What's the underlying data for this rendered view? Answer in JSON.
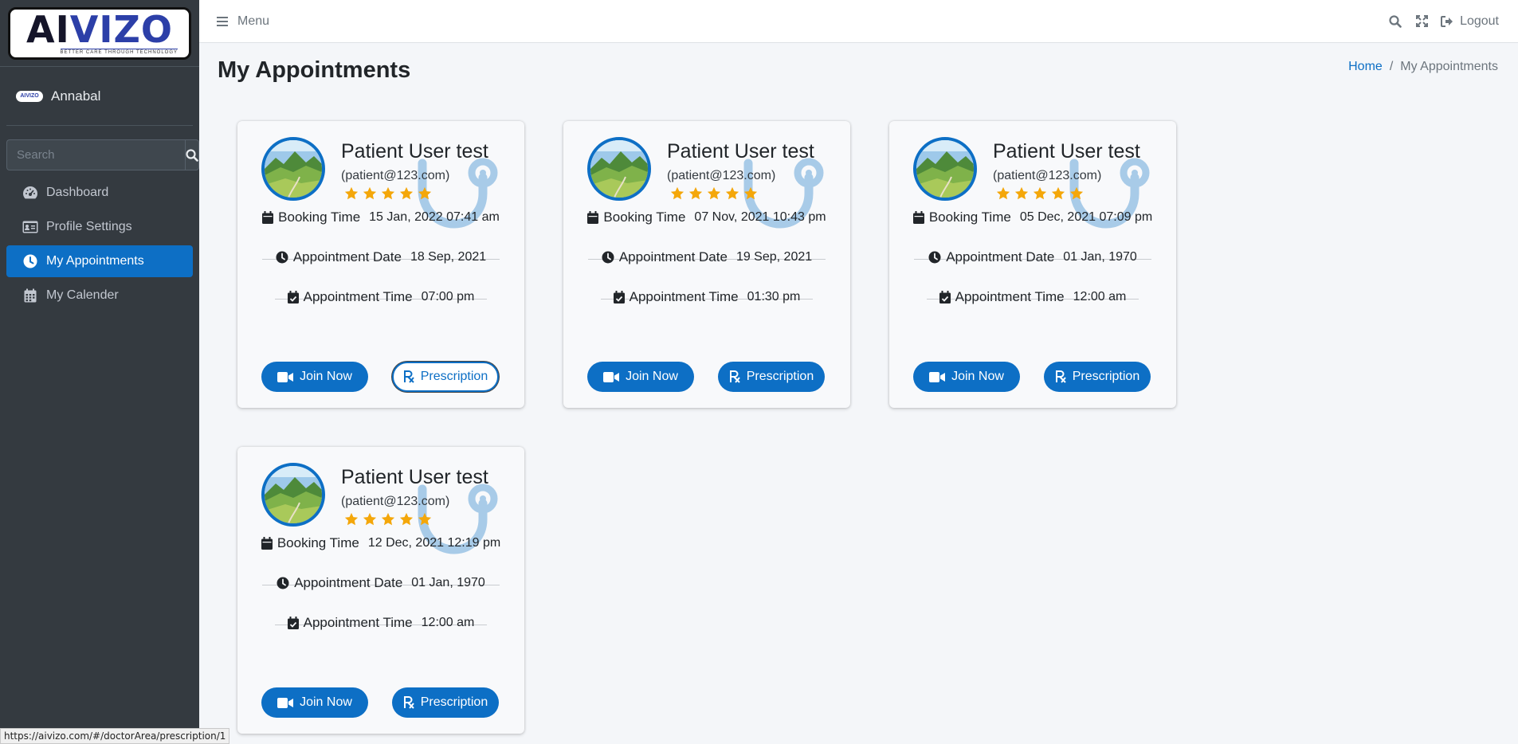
{
  "brand": {
    "logo_text_dark": "AI",
    "logo_text_accent": "VIZO",
    "logo_text_end": "",
    "tagline": "BETTER CARE THROUGH TECHNOLOGY"
  },
  "user": {
    "avatar_text": "AIVIZO",
    "name": "Annabal"
  },
  "search": {
    "placeholder": "Search"
  },
  "nav": {
    "items": [
      {
        "label": "Dashboard",
        "icon": "dashboard-icon"
      },
      {
        "label": "Profile Settings",
        "icon": "id-card-icon"
      },
      {
        "label": "My Appointments",
        "icon": "clock-icon",
        "active": true
      },
      {
        "label": "My Calender",
        "icon": "calendar-icon"
      }
    ]
  },
  "topbar": {
    "menu_label": "Menu",
    "logout_label": "Logout"
  },
  "page": {
    "title": "My Appointments"
  },
  "breadcrumb": {
    "home": "Home",
    "separator": "/",
    "current": "My Appointments"
  },
  "labels": {
    "booking": "Booking Time",
    "date": "Appointment Date",
    "time": "Appointment Time",
    "join": "Join Now",
    "prescription": "Prescription"
  },
  "cards": [
    {
      "name": "Patient User test",
      "email": "(patient@123.com)",
      "rating": 5,
      "booking_time": "15 Jan, 2022 07:41 am",
      "appointment_date": "18 Sep, 2021",
      "appointment_time": "07:00 pm"
    },
    {
      "name": "Patient User test",
      "email": "(patient@123.com)",
      "rating": 5,
      "booking_time": "07 Nov, 2021 10:43 pm",
      "appointment_date": "19 Sep, 2021",
      "appointment_time": "01:30 pm"
    },
    {
      "name": "Patient User test",
      "email": "(patient@123.com)",
      "rating": 5,
      "booking_time": "05 Dec, 2021 07:09 pm",
      "appointment_date": "01 Jan, 1970",
      "appointment_time": "12:00 am"
    },
    {
      "name": "Patient User test",
      "email": "(patient@123.com)",
      "rating": 5,
      "booking_time": "12 Dec, 2021 12:19 pm",
      "appointment_date": "01 Jan, 1970",
      "appointment_time": "12:00 am"
    }
  ],
  "status_bar": {
    "url": "https://aivizo.com/#/doctorArea/prescription/1"
  },
  "colors": {
    "primary": "#0d6fc5",
    "sidebar": "#343a40",
    "star": "#f4a70a",
    "watermark": "#a8cbe8"
  }
}
